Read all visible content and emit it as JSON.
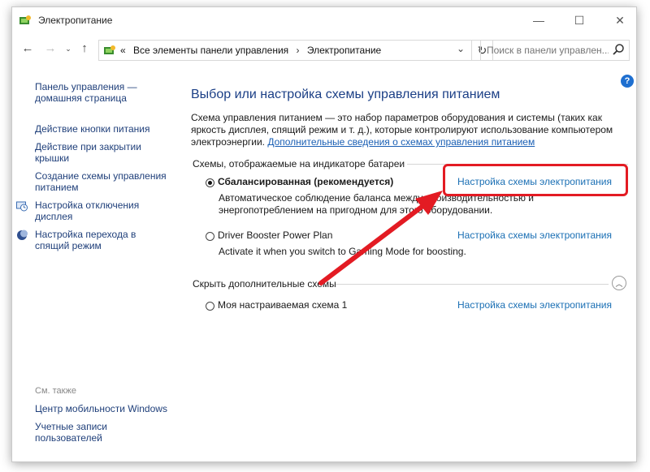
{
  "window": {
    "title": "Электропитание",
    "minimize_label": "—",
    "maximize_label": "☐",
    "close_label": "✕"
  },
  "address_bar": {
    "chevron": "«",
    "crumbs": [
      "Все элементы панели управления",
      "Электропитание"
    ],
    "separator": "›"
  },
  "search": {
    "placeholder": "Поиск в панели управлен..."
  },
  "sidebar": {
    "home": "Панель управления — домашняя страница",
    "items": [
      "Действие кнопки питания",
      "Действие при закрытии крышки",
      "Создание схемы управления питанием",
      "Настройка отключения дисплея",
      "Настройка перехода в спящий режим"
    ],
    "see_also_heading": "См. также",
    "see_also": [
      "Центр мобильности Windows",
      "Учетные записи пользователей"
    ]
  },
  "main": {
    "heading": "Выбор или настройка схемы управления питанием",
    "description": "Схема управления питанием — это набор параметров оборудования и системы (таких как яркость дисплея, спящий режим и т. д.), которые контролируют использование компьютером электроэнергии.",
    "description_link": "Дополнительные сведения о схемах управления питанием",
    "group_battery": "Схемы, отображаемые на индикаторе батареи",
    "group_hidden": "Скрыть дополнительные схемы",
    "plans": [
      {
        "name": "Сбалансированная (рекомендуется)",
        "selected": true,
        "description": "Автоматическое соблюдение баланса между производительностью и энергопотреблением на пригодном для этого оборудовании.",
        "link": "Настройка схемы электропитания"
      },
      {
        "name": "Driver Booster Power Plan",
        "selected": false,
        "description": "Activate it when you switch to Gaming Mode for boosting.",
        "link": "Настройка схемы электропитания"
      },
      {
        "name": "Моя настраиваемая схема 1",
        "selected": false,
        "description": "",
        "link": "Настройка схемы электропитания"
      }
    ]
  },
  "colors": {
    "link": "#1a6fb4",
    "heading": "#1b3f86",
    "highlight": "#e31b23",
    "help": "#1e6fd0"
  }
}
